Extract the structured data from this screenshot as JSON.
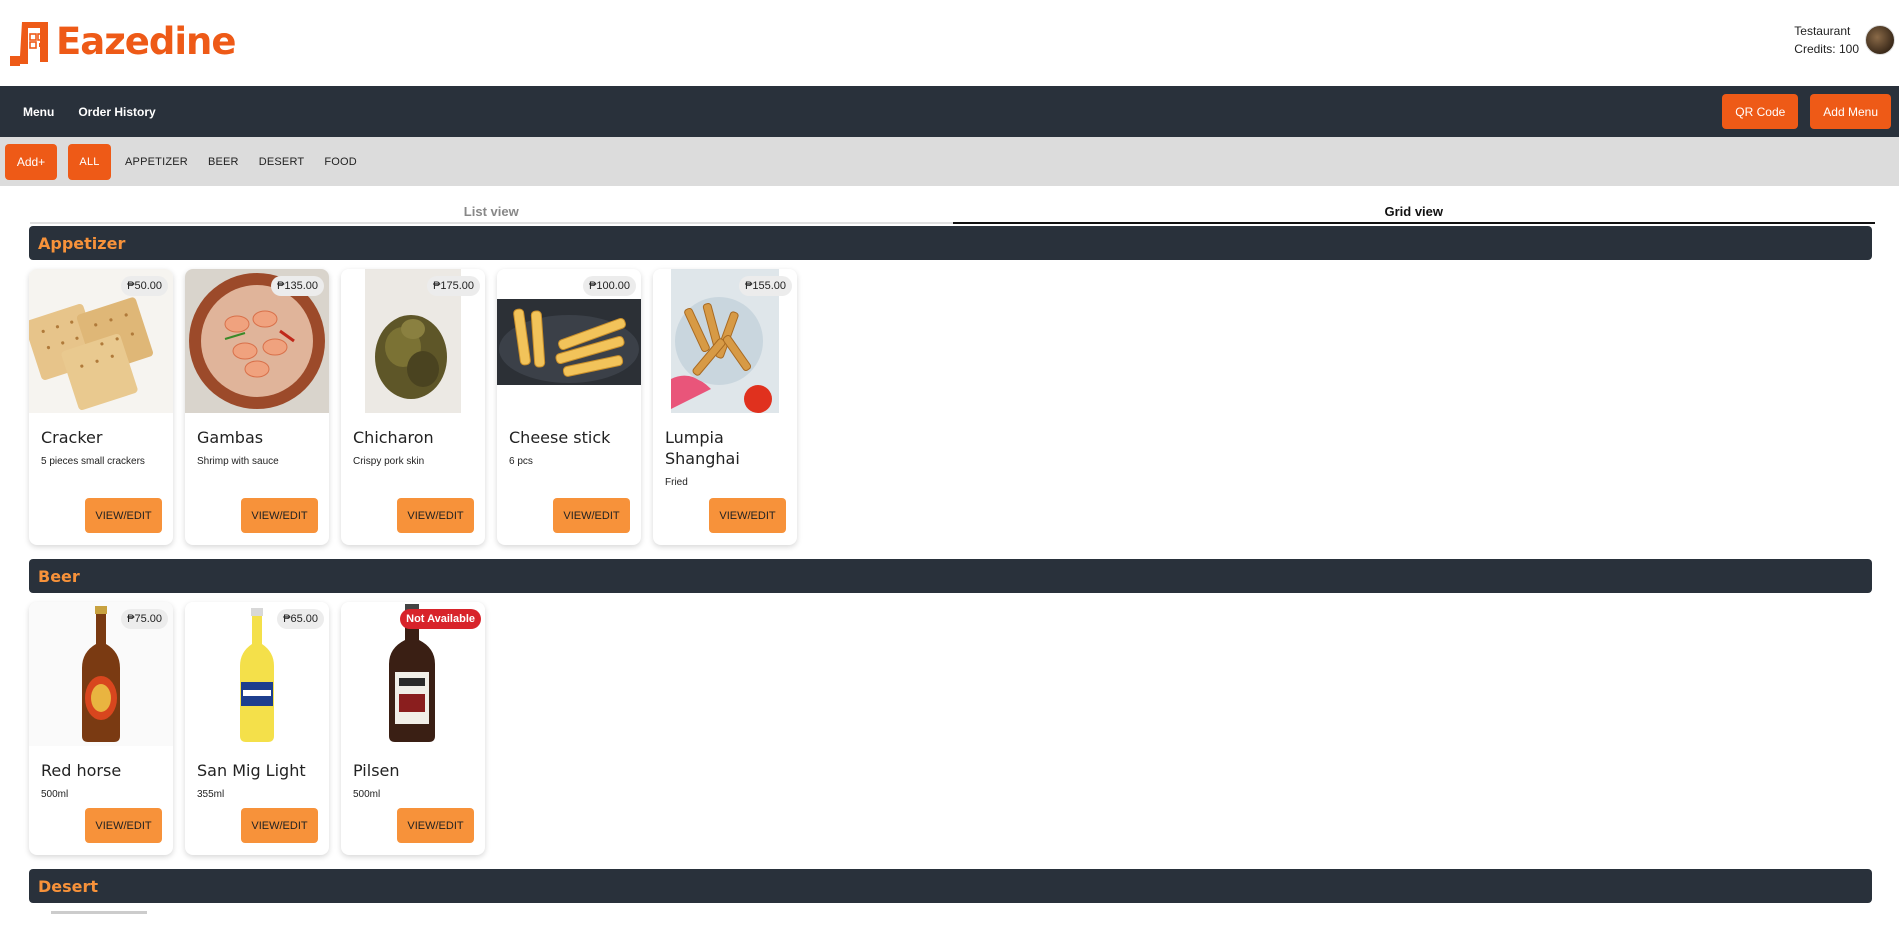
{
  "header": {
    "brand": "Eazedine",
    "user_name": "Testaurant",
    "credits": "Credits: 100"
  },
  "nav": {
    "menu": "Menu",
    "order_history": "Order History",
    "qr_code": "QR Code",
    "add_menu": "Add Menu"
  },
  "categories": {
    "add": "Add+",
    "items": [
      "ALL",
      "APPETIZER",
      "BEER",
      "DESERT",
      "FOOD"
    ],
    "active": "ALL"
  },
  "views": {
    "list": "List view",
    "grid": "Grid view",
    "selected": "Grid view"
  },
  "sections": {
    "appetizer": {
      "title": "Appetizer",
      "items": [
        {
          "name": "Cracker",
          "desc": "5 pieces small crackers",
          "price": "₱50.00",
          "button": "VIEW/EDIT"
        },
        {
          "name": "Gambas",
          "desc": "Shrimp with sauce",
          "price": "₱135.00",
          "button": "VIEW/EDIT"
        },
        {
          "name": "Chicharon",
          "desc": "Crispy pork skin",
          "price": "₱175.00",
          "button": "VIEW/EDIT"
        },
        {
          "name": "Cheese stick",
          "desc": "6 pcs",
          "price": "₱100.00",
          "button": "VIEW/EDIT"
        },
        {
          "name": "Lumpia Shanghai",
          "desc": "Fried",
          "price": "₱155.00",
          "button": "VIEW/EDIT"
        }
      ]
    },
    "beer": {
      "title": "Beer",
      "items": [
        {
          "name": "Red horse",
          "desc": "500ml",
          "price": "₱75.00",
          "button": "VIEW/EDIT"
        },
        {
          "name": "San Mig Light",
          "desc": "355ml",
          "price": "₱65.00",
          "button": "VIEW/EDIT"
        },
        {
          "name": "Pilsen",
          "desc": "500ml",
          "price": "Not Available",
          "button": "VIEW/EDIT"
        }
      ]
    },
    "desert": {
      "title": "Desert"
    }
  },
  "colors": {
    "brand_orange": "#ee5a17",
    "accent_orange": "#f7923a",
    "navbar": "#29313b",
    "unavailable_red": "#d8232a"
  }
}
